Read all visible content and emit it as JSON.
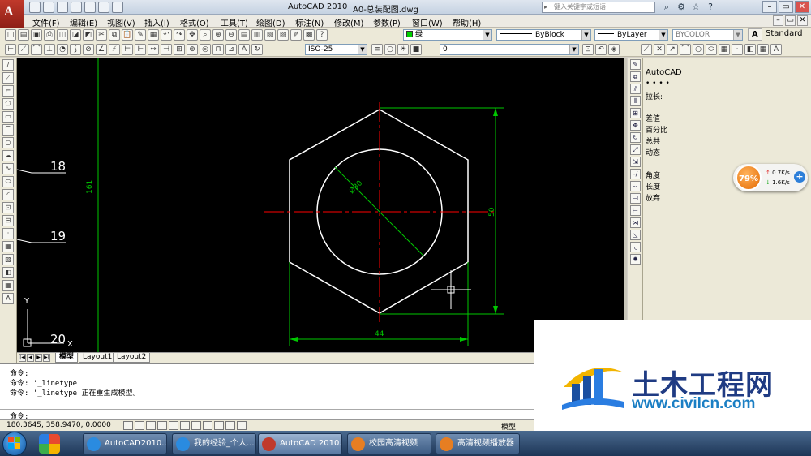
{
  "window": {
    "app_title": "AutoCAD 2010",
    "file_name": "A0-总装配图.dwg",
    "search_placeholder": "键入关键字或短语"
  },
  "menu": [
    "文件(F)",
    "编辑(E)",
    "视图(V)",
    "插入(I)",
    "格式(O)",
    "工具(T)",
    "绘图(D)",
    "标注(N)",
    "修改(M)",
    "参数(P)",
    "窗口(W)",
    "帮助(H)"
  ],
  "properties_toolbar": {
    "color": "绿",
    "linetype": "ByBlock",
    "lineweight": "ByLayer",
    "plotstyle": "BYCOLOR",
    "text_style": "Standard"
  },
  "dim_toolbar": {
    "dim_style": "ISO-25",
    "layer": "0"
  },
  "drawing": {
    "hex_across_flats_dim": "50",
    "hex_width_dim": "44",
    "circle_dia_dim": "Ø30",
    "vertical_dim": "161",
    "balloon_18": "18",
    "balloon_19": "19",
    "balloon_20": "20",
    "ucs_x": "X",
    "ucs_y": "Y",
    "colors": {
      "outline": "#ffffff",
      "center": "#ff0000",
      "dimension": "#00c800"
    }
  },
  "layout_tabs": [
    "模型",
    "Layout1",
    "Layout2"
  ],
  "properties_palette": {
    "title": "AutoCAD",
    "dots": "• • • •",
    "lengthen_label": "拉长:",
    "options": [
      "差值",
      "百分比",
      "总共",
      "动态"
    ],
    "options2": [
      "角度",
      "长度",
      "放弃"
    ]
  },
  "net_widget": {
    "percent": "79%",
    "up": "0.7K/s",
    "down": "1.6K/s"
  },
  "command_line": {
    "lines": [
      {
        "prompt": "命令:",
        "text": ""
      },
      {
        "prompt": "命令:",
        "text": "'_linetype"
      },
      {
        "prompt": "命令:",
        "text": "'_linetype 正在重生成模型。"
      }
    ],
    "current_prompt": "命令:"
  },
  "status_bar": {
    "coords": "180.3645,  358.9470,  0.0000",
    "space": "模型"
  },
  "taskbar": {
    "items": [
      {
        "label": "AutoCAD2010...",
        "color": "#2a8be0"
      },
      {
        "label": "我的经验_个人...",
        "color": "#2a8be0"
      },
      {
        "label": "AutoCAD 2010...",
        "color": "#c0392b"
      },
      {
        "label": "校园高清视频",
        "color": "#e67e22"
      },
      {
        "label": "高清视频播放器",
        "color": "#e67e22"
      }
    ]
  },
  "watermark": {
    "brand": "土木工程网",
    "url": "www.civilcn.com"
  }
}
